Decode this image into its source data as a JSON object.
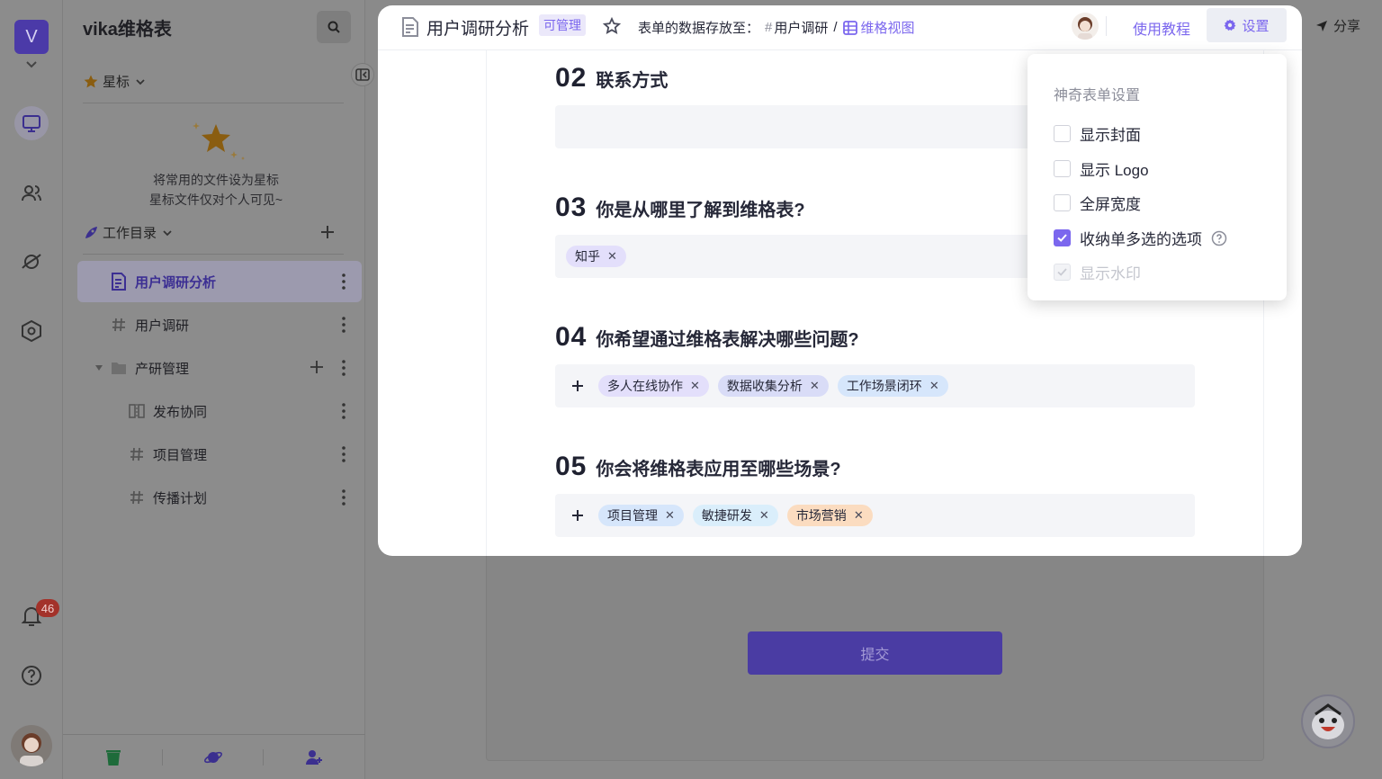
{
  "workspace": {
    "initial": "V"
  },
  "rail": {
    "notification_count": "46"
  },
  "sidebar": {
    "title": "vika维格表",
    "starred_label": "星标",
    "starred_empty_line1": "将常用的文件设为星标",
    "starred_empty_line2": "星标文件仅对个人可见~",
    "catalog_label": "工作目录",
    "items": [
      {
        "label": "用户调研分析"
      },
      {
        "label": "用户调研"
      },
      {
        "label": "产研管理"
      },
      {
        "label": "发布协同"
      },
      {
        "label": "项目管理"
      },
      {
        "label": "传播计划"
      }
    ]
  },
  "header": {
    "title": "用户调研分析",
    "permission": "可管理",
    "store_prefix": "表单的数据存放至：",
    "store_sheet": "用户调研",
    "store_sep": "/",
    "store_view": "维格视图",
    "tutorial": "使用教程",
    "settings": "设置",
    "share": "分享"
  },
  "form": {
    "questions": [
      {
        "num": "02",
        "text": "联系方式"
      },
      {
        "num": "03",
        "text": "你是从哪里了解到维格表?",
        "tags": [
          "知乎"
        ]
      },
      {
        "num": "04",
        "text": "你希望通过维格表解决哪些问题?",
        "tags": [
          "多人在线协作",
          "数据收集分析",
          "工作场景闭环"
        ]
      },
      {
        "num": "05",
        "text": "你会将维格表应用至哪些场景?",
        "tags": [
          "项目管理",
          "敏捷研发",
          "市场营销"
        ]
      }
    ],
    "submit": "提交"
  },
  "settings_popover": {
    "title": "神奇表单设置",
    "options": [
      {
        "label": "显示封面",
        "checked": false
      },
      {
        "label": "显示 Logo",
        "checked": false
      },
      {
        "label": "全屏宽度",
        "checked": false
      },
      {
        "label": "收纳单多选的选项",
        "checked": true
      },
      {
        "label": "显示水印",
        "checked": true,
        "disabled": true
      }
    ]
  },
  "colors": {
    "accent": "#7b67ee",
    "tag_purple": "#e3dffb",
    "tag_blue": "#d6e6fb",
    "tag_orange": "#fbdcc0"
  }
}
